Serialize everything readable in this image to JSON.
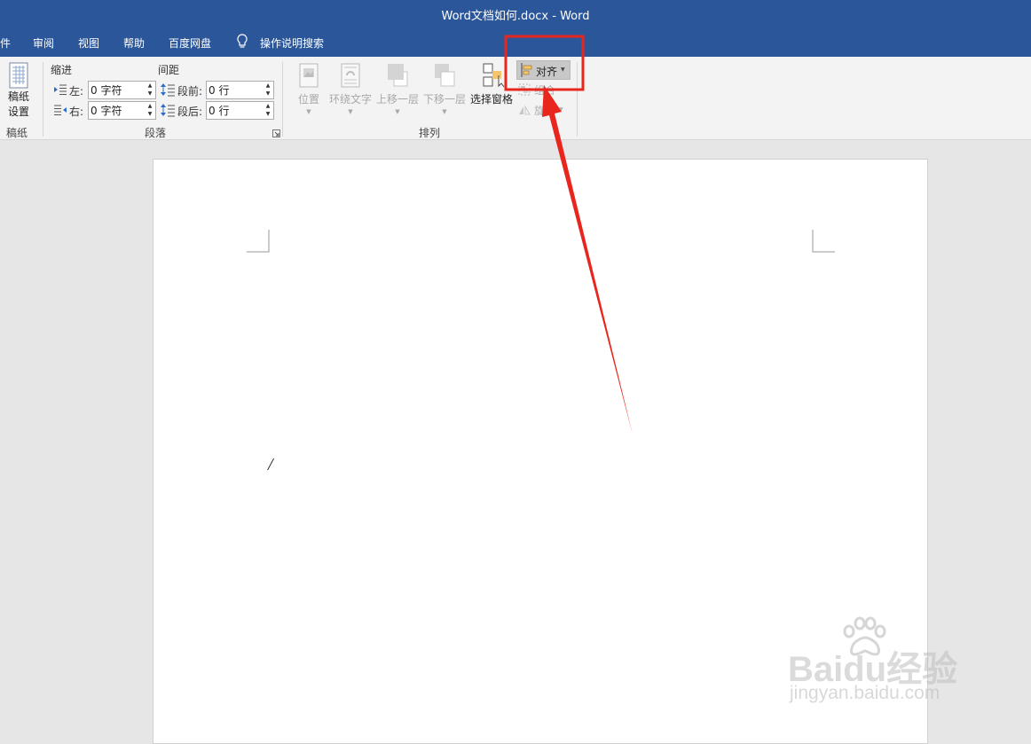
{
  "window": {
    "title": "Word文档如何.docx  -  Word"
  },
  "menu": {
    "tabs": [
      "件",
      "审阅",
      "视图",
      "帮助",
      "百度网盘"
    ],
    "search": "操作说明搜索"
  },
  "ribbon": {
    "manuscript": {
      "button_label_1": "稿纸",
      "button_label_2": "设置",
      "group_label": "稿纸"
    },
    "paragraph": {
      "indent_header": "缩进",
      "spacing_header": "间距",
      "left_label": "左:",
      "right_label": "右:",
      "left_value": "0 字符",
      "right_value": "0 字符",
      "before_label": "段前:",
      "after_label": "段后:",
      "before_value": "0 行",
      "after_value": "0 行",
      "group_label": "段落"
    },
    "arrange": {
      "position": "位置",
      "wrap_text": "环绕文字",
      "bring_forward": "上移一层",
      "send_backward": "下移一层",
      "selection_pane": "选择窗格",
      "align": "对齐",
      "group": "组合",
      "rotate": "旋转",
      "group_label": "排列"
    }
  },
  "document": {
    "cursor_char": "/"
  },
  "watermark": {
    "logo": "Baidu经验",
    "url": "jingyan.baidu.com"
  },
  "annotation": {
    "highlight_color": "#e8261d"
  },
  "colors": {
    "accent": "#2b579a",
    "ribbon": "#f3f3f3",
    "page": "#ffffff",
    "canvas": "#e6e6e6"
  }
}
